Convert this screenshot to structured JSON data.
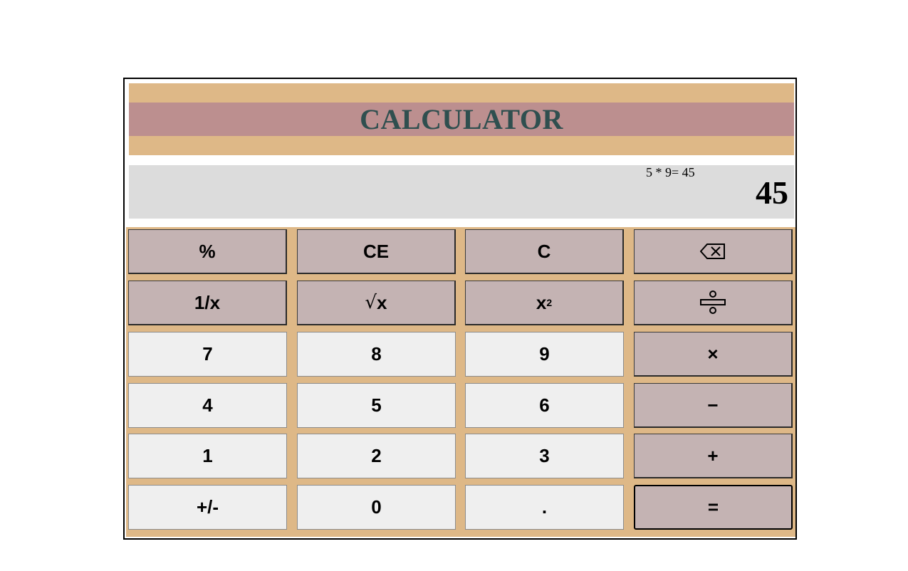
{
  "header": {
    "title": "CALCULATOR"
  },
  "display": {
    "expression": "5 * 9= 45",
    "result": "45"
  },
  "keypad": {
    "rows": [
      [
        "%",
        "CE",
        "C",
        "backspace"
      ],
      [
        "1/x",
        "√x",
        "x²",
        "divide"
      ],
      [
        "7",
        "8",
        "9",
        "×"
      ],
      [
        "4",
        "5",
        "6",
        "−"
      ],
      [
        "1",
        "2",
        "3",
        "+"
      ],
      [
        "+/-",
        "0",
        ".",
        "="
      ]
    ],
    "labels": {
      "percent": "%",
      "ce": "CE",
      "c": "C",
      "reciprocal": "1/x",
      "sqrt_symbol": "√",
      "sqrt_var": "x",
      "square_base": "x",
      "square_exp": "2",
      "seven": "7",
      "eight": "8",
      "nine": "9",
      "multiply": "×",
      "four": "4",
      "five": "5",
      "six": "6",
      "minus": "−",
      "one": "1",
      "two": "2",
      "three": "3",
      "plus": "+",
      "negate": "+/-",
      "zero": "0",
      "decimal": ".",
      "equals": "="
    },
    "icons": {
      "backspace": "backspace-icon",
      "divide": "divide-icon"
    }
  },
  "colors": {
    "header_band": "#deb887",
    "title_band": "#bc8f8f",
    "title_text": "#2f4f4f",
    "display_bg": "#dcdcdc",
    "operator_btn": "#c4b3b3",
    "number_btn": "#efefef",
    "keypad_bg": "#deb887"
  }
}
